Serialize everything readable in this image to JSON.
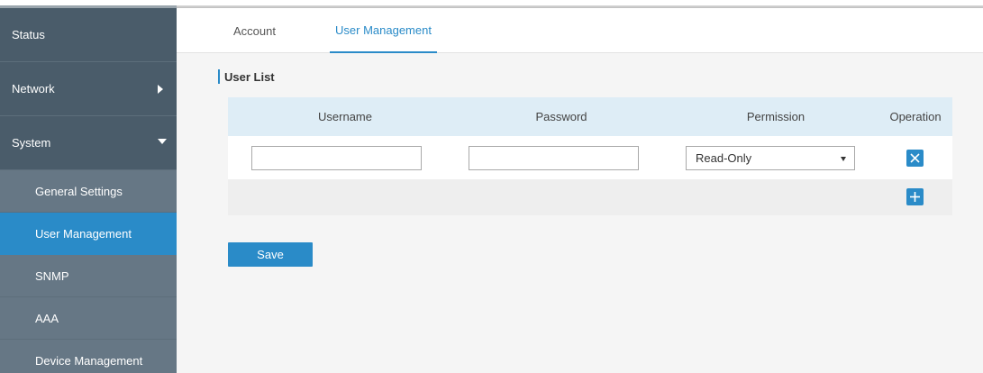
{
  "sidebar": {
    "items": [
      {
        "label": "Status"
      },
      {
        "label": "Network"
      },
      {
        "label": "System"
      },
      {
        "label": "General Settings"
      },
      {
        "label": "User Management"
      },
      {
        "label": "SNMP"
      },
      {
        "label": "AAA"
      },
      {
        "label": "Device Management"
      }
    ],
    "active_item": "User Management"
  },
  "tabs": [
    {
      "label": "Account"
    },
    {
      "label": "User Management"
    }
  ],
  "active_tab": "User Management",
  "section": {
    "title": "User List"
  },
  "table": {
    "columns": [
      "Username",
      "Password",
      "Permission",
      "Operation"
    ],
    "rows": [
      {
        "username": "",
        "password": "",
        "permission": "Read-Only"
      }
    ],
    "permission_options": [
      "Read-Only"
    ]
  },
  "buttons": {
    "save_label": "Save"
  },
  "icons": {
    "delete": "close-icon",
    "add": "plus-icon",
    "network_expand": "caret-right-icon",
    "system_expand": "caret-down-icon"
  },
  "colors": {
    "accent": "#2a8bc8",
    "sidebar_bg": "#4a5c6a",
    "sidebar_sub_bg": "#667785",
    "table_header_bg": "#deedf6"
  }
}
